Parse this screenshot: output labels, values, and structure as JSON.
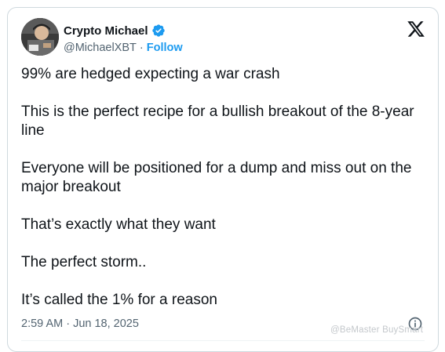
{
  "author": {
    "name": "Crypto Michael",
    "handle": "@MichaelXBT",
    "separator": "·",
    "follow_label": "Follow"
  },
  "tweet": {
    "paragraphs": [
      "99% are hedged expecting a war crash",
      "This is the perfect recipe for a bullish breakout of the 8-year line",
      "Everyone will be positioned for a dump and miss out on the major breakout",
      "That’s exactly what they want",
      "The perfect storm..",
      "It’s called the 1% for a reason"
    ],
    "timestamp": "2:59 AM · Jun 18, 2025"
  },
  "watermark": "@BeMaster BuySmart",
  "colors": {
    "accent": "#1d9bf0",
    "text": "#0f1419",
    "secondary_text": "#536471",
    "border": "#cfd9de"
  },
  "icons": {
    "verified": "verified-badge-icon",
    "x_logo": "x-logo-icon",
    "info": "info-icon"
  }
}
